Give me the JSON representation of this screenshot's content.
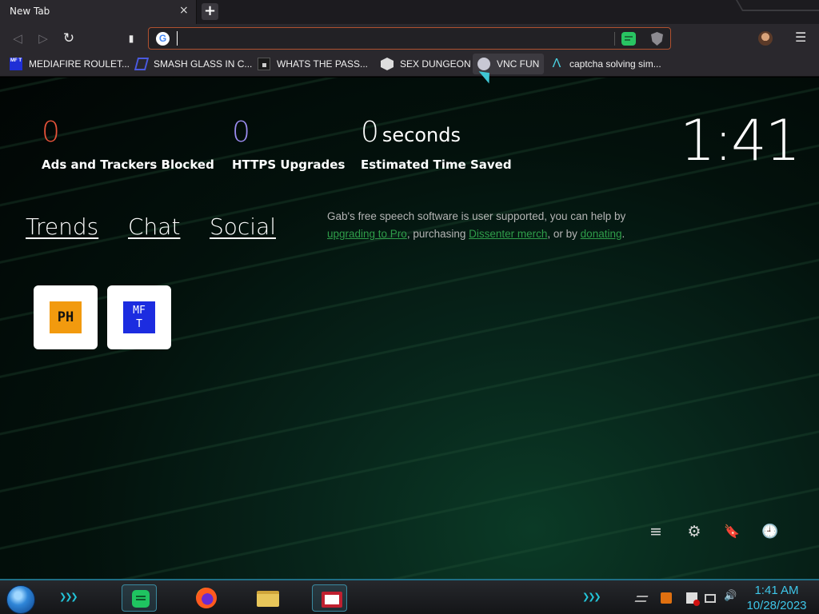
{
  "browser": {
    "tab_title": "New Tab",
    "tab_close": "×",
    "new_tab": "+",
    "menu": "☰",
    "back": "◁",
    "forward": "▷",
    "reload": "↻",
    "bookmark_icon": "🔖",
    "google_letter": "G",
    "address_value": "",
    "border_accent": "#b0512f"
  },
  "bookmarks": [
    {
      "label": "MEDIAFIRE ROULET...",
      "icon": "mft-icon"
    },
    {
      "label": "SMASH GLASS IN C...",
      "icon": "smash-icon"
    },
    {
      "label": "WHATS THE PASS...",
      "icon": "dark-square-icon"
    },
    {
      "label": "SEX DUNGEON",
      "icon": "dungeon-icon"
    },
    {
      "label": "VNC FUN",
      "icon": "vnc-icon"
    },
    {
      "label": "captcha solving sim...",
      "icon": "captcha-icon"
    }
  ],
  "bookmark_icon_text": {
    "mft": "MF T",
    "captcha": "Λ"
  },
  "stats": {
    "ads_blocked": {
      "value": "0",
      "label": "Ads and Trackers Blocked",
      "color": "#e8533a"
    },
    "https_upgrades": {
      "value": "0",
      "label": "HTTPS Upgrades",
      "color": "#9b8cf0"
    },
    "time_saved": {
      "value": "0",
      "unit": "seconds",
      "label": "Estimated Time Saved",
      "color": "#ffffff"
    }
  },
  "clock": "1:41",
  "nav_links": [
    "Trends",
    "Chat",
    "Social"
  ],
  "gab_message": {
    "part1": "Gab's free speech software is user supported, you can help by ",
    "link1": "upgrading to Pro",
    "part2": ", purchasing ",
    "link2": "Dissenter merch",
    "part3": ", or by ",
    "link3": "donating",
    "part4": "."
  },
  "tiles": [
    {
      "name": "ph",
      "text": "PH"
    },
    {
      "name": "mft",
      "text_top": "MF",
      "text_bottom": "T"
    }
  ],
  "controls": {
    "customize": "≡",
    "settings": "⚙",
    "bookmarks": "🔖",
    "history": "🕘"
  },
  "taskbar": {
    "time": "1:41 AM",
    "date": "10/28/2023",
    "chevrons": "❯❯❯",
    "volume": "🔊"
  }
}
